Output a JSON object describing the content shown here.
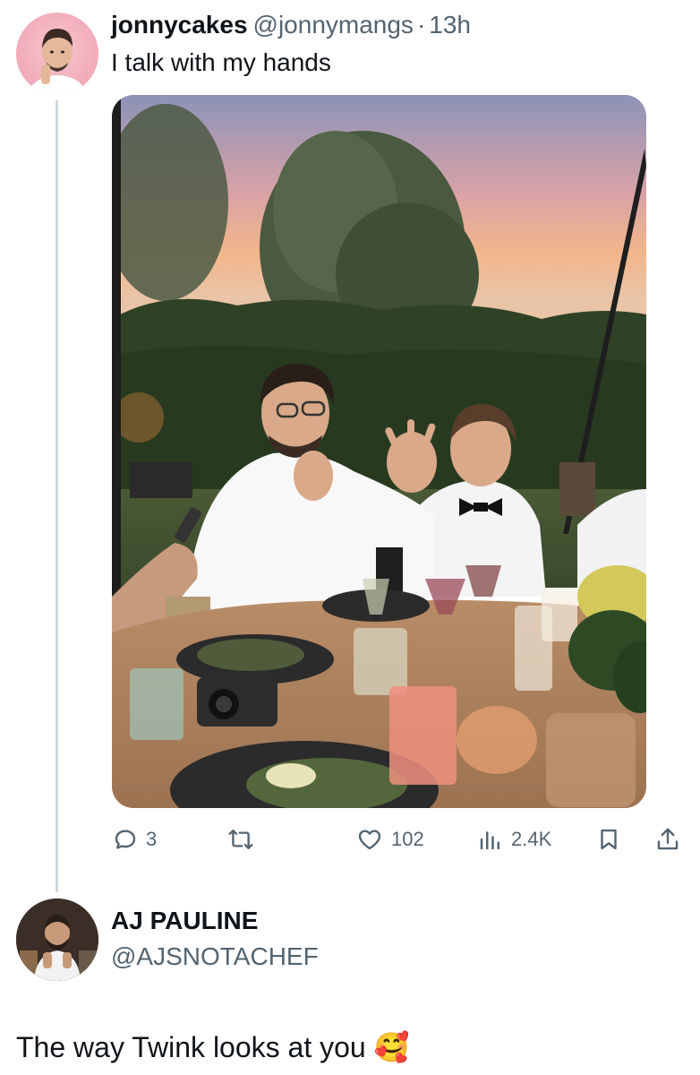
{
  "tweet": {
    "display_name": "jonnycakes",
    "handle": "@jonnymangs",
    "separator": "·",
    "time": "13h",
    "text": "I talk with my hands",
    "media_description_icon": "photo",
    "stats": {
      "replies": "3",
      "retweets": "",
      "likes": "102",
      "views": "2.4K"
    }
  },
  "reply": {
    "display_name": "AJ PAULINE",
    "handle": "@AJSNOTACHEF",
    "text": "The way Twink looks at you 🥰"
  },
  "colors": {
    "text": "#0f1419",
    "muted": "#536471",
    "thread_line": "#cfd9de"
  }
}
